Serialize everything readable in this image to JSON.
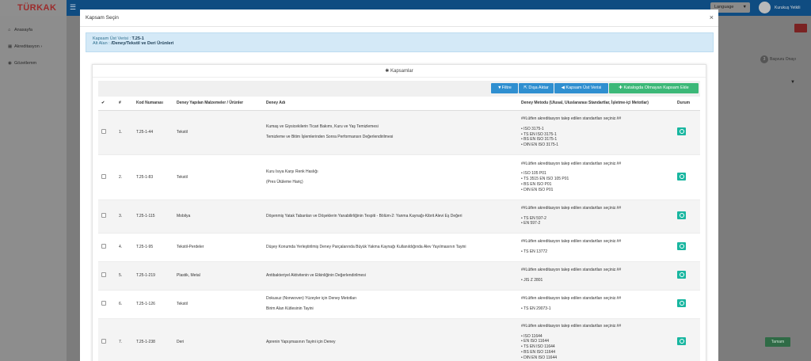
{
  "app": {
    "logo": "TÜRKAK",
    "language": "Language",
    "user": "Kurukuş Yetkili"
  },
  "sidebar": {
    "items": [
      {
        "label": "Anasayfa",
        "icon": "home-icon"
      },
      {
        "label": "Akreditasyon",
        "icon": "chart-icon"
      },
      {
        "label": "Gözetlemm",
        "icon": "check-circle-icon"
      }
    ]
  },
  "background": {
    "step": "Başvuru Onayı",
    "step_num": "3",
    "done_button": "Tamam"
  },
  "modal": {
    "title": "Kapsam Seçin",
    "close": "×",
    "info_line1_label": "Kapsam Üst Verisi : ",
    "info_line1_value": "T.25-1",
    "info_line2_label": "Alt Alan : ",
    "info_line2_value": "/Deney/Tekstil ve Deri Ürünleri",
    "panel_title": "Kapsamlar",
    "toolbar": {
      "filter": "Filtre",
      "export": "Dışa Aktar",
      "scope": "Kapsam Üst Verisi",
      "add": "Katalogda Olmayan Kapsam Ekle"
    },
    "columns": [
      "✔",
      "#",
      "Kod Numarası",
      "Deney Yapılan Malzemeler / Ürünler",
      "Deney Adı",
      "Deney Metodu (Ulusal, Uluslararası Standartlar, İşletme-içi Metotlar)",
      "Durum"
    ],
    "rows": [
      {
        "no": "1.",
        "code": "T.25-1-44",
        "material": "Tekstil",
        "test": [
          "Kumaş ve Giysicekilerin Ticari Bakımı, Kuru ve Yaş Temizlemesi",
          "Temizleme ve Bitim İşlemlerinden Sonra Performansın Değerlendirilmesi"
        ],
        "note": "##Lütfen akreditasyon talep edilen standartları seçiniz.##",
        "methods": [
          "ISO 3175-1",
          "TS EN ISO 3175-1",
          "BS EN ISO 3175-1",
          "DIN EN ISO 3175-1"
        ]
      },
      {
        "no": "2.",
        "code": "T.25-1-83",
        "material": "Tekstil",
        "test": [
          "Kuru Isıya Karşı Renk Haslığı",
          "(Pres Ütüleme Hariç)"
        ],
        "note": "##Lütfen akreditasyon talep edilen standartları seçiniz.##",
        "methods": [
          "ISO 105 P01",
          "TS 3515 EN ISO 105 P01",
          "BS EN ISO P01",
          "DIN EN ISO P01"
        ]
      },
      {
        "no": "3.",
        "code": "T.25-1-115",
        "material": "Mobilya",
        "test": [
          "Döşenmiş Yatak Tabanları ve Döşeklerin Yanabilirliğinin Tespiti - Bölüm-2: Yanma Kaynağı-Kibrit Alevi Eş Değeri"
        ],
        "note": "##Lütfen akreditasyon talep edilen standartları seçiniz.##",
        "methods": [
          "TS EN 597-2",
          "EN 597-2"
        ]
      },
      {
        "no": "4.",
        "code": "T.25-1-95",
        "material": "Tekstil-Perdeler",
        "test": [
          "Düşey Konumda Yerleştirilmiş Deney Parçalarında Büyük Yakma Kaynağı Kullanıldığında Alev Yayılmasının Tayini"
        ],
        "note": "##Lütfen akreditasyon talep edilen standartları seçiniz.##",
        "methods": [
          "TS EN 13772"
        ]
      },
      {
        "no": "5.",
        "code": "T.25-1-219",
        "material": "Plastik, Metal",
        "test": [
          "Antibakteriyel Aktivitenin ve Etkinliğinin Değerlendirilmesi"
        ],
        "note": "##Lütfen akreditasyon talep edilen standartları seçiniz.##",
        "methods": [
          "JIS Z 2801"
        ]
      },
      {
        "no": "6.",
        "code": "T.25-1-126",
        "material": "Tekstil",
        "test": [
          "Dokusuz (Nonwoven) Yüzeyler için Deney Metotları",
          "Birim Alan Kütlesinin Tayini"
        ],
        "note": "##Lütfen akreditasyon talep edilen standartları seçiniz.##",
        "methods": [
          "TS EN 29073-1"
        ]
      },
      {
        "no": "7.",
        "code": "T.25-1-238",
        "material": "Deri",
        "test": [
          "Aprenin Yapışmasının Tayini için Deney"
        ],
        "note": "##Lütfen akreditasyon talep edilen standartları seçiniz.##",
        "methods": [
          "ISO 11644",
          "EN ISO 11644",
          "TS EN ISO 11644",
          "BS EN ISO 11644",
          "DIN EN ISO 11644"
        ]
      }
    ]
  }
}
